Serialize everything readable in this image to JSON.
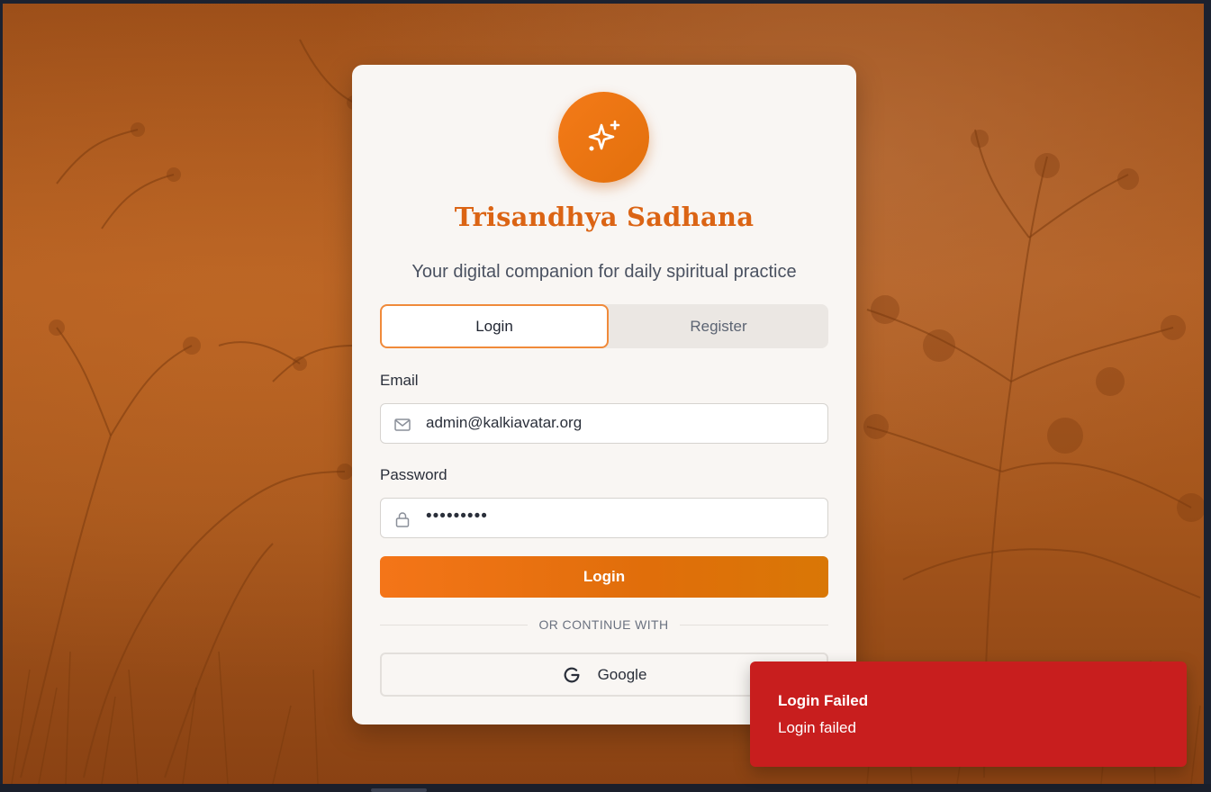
{
  "app": {
    "title": "Trisandhya Sadhana",
    "subtitle": "Your digital companion for daily spiritual practice",
    "logo_icon": "sparkles-icon",
    "accent_color": "#db6414"
  },
  "tabs": {
    "login_label": "Login",
    "register_label": "Register",
    "active": "Login"
  },
  "form": {
    "email_label": "Email",
    "email_value": "admin@kalkiavatar.org",
    "email_icon": "mail-icon",
    "password_label": "Password",
    "password_value": "•••••••••",
    "password_icon": "lock-icon",
    "submit_label": "Login"
  },
  "divider": {
    "text": "OR CONTINUE WITH"
  },
  "oauth": {
    "google_label": "Google",
    "google_icon": "google-icon"
  },
  "toast": {
    "title": "Login Failed",
    "message": "Login failed",
    "color": "#c81e1e"
  }
}
